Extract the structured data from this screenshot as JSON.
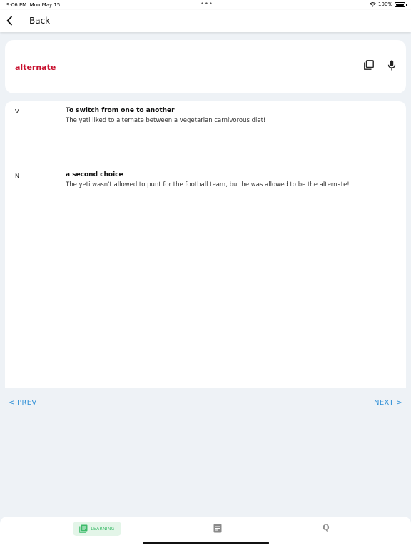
{
  "status_bar": {
    "time": "9:06 PM",
    "date": "Mon May 15",
    "dots": "•••",
    "battery": "100%",
    "battery_level": 1.0,
    "wifi_icon": "wifi-icon",
    "battery_icon": "battery-icon"
  },
  "nav": {
    "back_icon": "chevron-left-icon",
    "back_label": "Back"
  },
  "word_card": {
    "word": "alternate",
    "copy_icon": "copy-icon",
    "mic_icon": "microphone-icon"
  },
  "definitions": [
    {
      "part_of_speech": "V",
      "meaning": "To switch from one to another",
      "example": "The yeti liked to alternate between a vegetarian carnivorous diet!"
    },
    {
      "part_of_speech": "N",
      "meaning": "a second choice",
      "example": "The yeti wasn't allowed to punt for the football team, but he was allowed to be the alternate!"
    }
  ],
  "pager": {
    "prev_label": "< PREV",
    "next_label": "NEXT >"
  },
  "tab_bar": {
    "learning_label": "LEARNING",
    "learning_icon": "book-icon",
    "notes_icon": "document-icon",
    "quiz_icon_glyph": "Q"
  },
  "colors": {
    "background": "#eef2f6",
    "word_red": "#c8102e",
    "link_blue": "#2e8fd6",
    "active_tab_bg": "#e3f5e8",
    "active_tab_fg": "#3dbb6a"
  }
}
